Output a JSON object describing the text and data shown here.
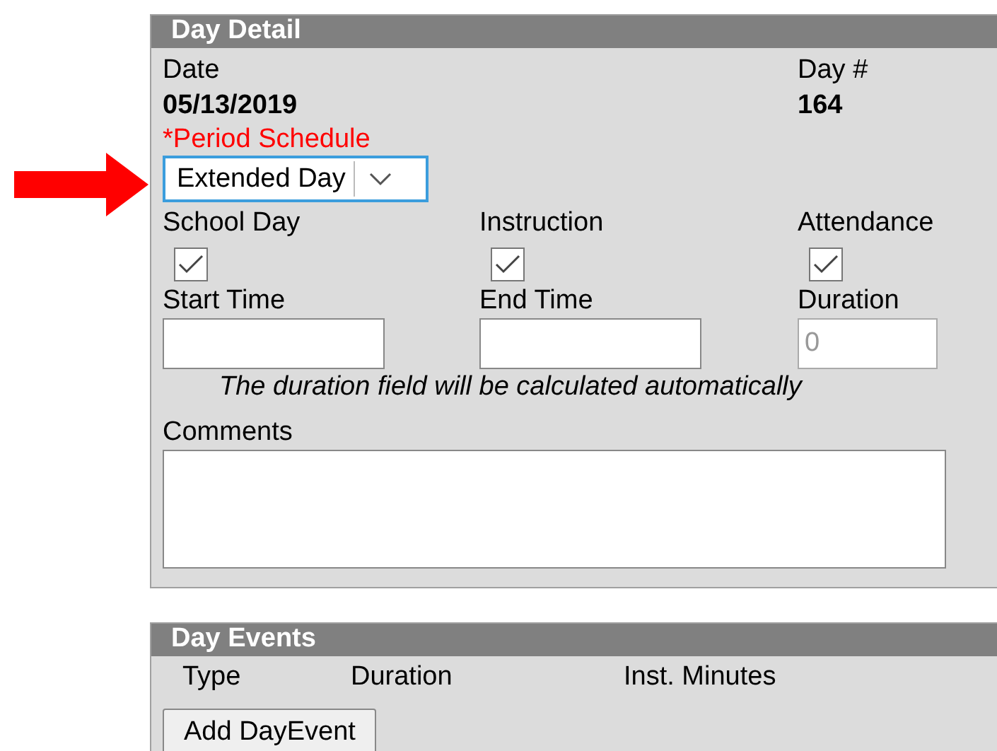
{
  "day_detail": {
    "title": "Day Detail",
    "info": [
      {
        "label": "Date",
        "value": "05/13/2019"
      },
      {
        "label": "Day #",
        "value": "164"
      }
    ],
    "period_schedule": {
      "label": "*Period Schedule",
      "value": "Extended Day",
      "focused": true
    },
    "checkboxes": [
      {
        "label": "School Day",
        "checked": true
      },
      {
        "label": "Instruction",
        "checked": true
      },
      {
        "label": "Attendance",
        "checked": true
      }
    ],
    "times": [
      {
        "label": "Start Time",
        "disabled": false
      },
      {
        "label": "End Time",
        "disabled": false
      },
      {
        "label": "Duration",
        "placeholder": "0",
        "disabled": true
      }
    ],
    "note": "The duration field will be calculated automatically",
    "comments_label": "Comments"
  },
  "day_events": {
    "title": "Day Events",
    "columns": [
      "Type",
      "Duration",
      "Inst. Minutes"
    ],
    "button": "Add DayEvent"
  }
}
